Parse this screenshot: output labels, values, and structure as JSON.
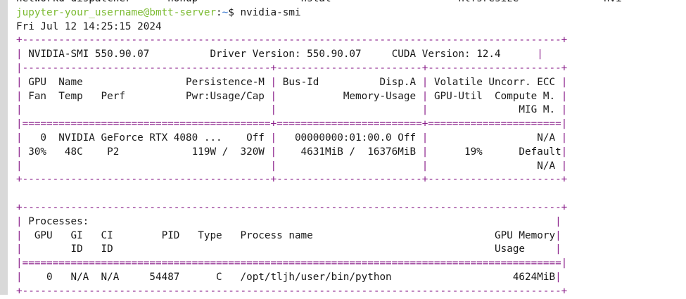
{
  "terminal": {
    "tail_line": "networkd-dispatcher      nohup                 nstat                     ntfsresize              nvi",
    "prompt": {
      "user_host": "jupyter-your_username@bmtt-server",
      "separator": ":",
      "path": "~",
      "symbol": "$ ",
      "command": "nvidia-smi"
    },
    "timestamp": "Fri Jul 12 14:25:15 2024",
    "smi_header": {
      "border": "+-----------------------------------------------------------------------------------------+",
      "smi_version": "NVIDIA-SMI 550.90.07",
      "driver_version": "Driver Version: 550.90.07",
      "cuda_version": "CUDA Version: 12.4"
    },
    "gpu_table": {
      "border_thin": "|-----------------------------------------+------------------------+----------------------+",
      "border_double": "|=========================================+========================+======================|",
      "border_bottom": "+-----------------------------------------+------------------------+----------------------+",
      "header_rows": [
        [
          "GPU  Name                 Persistence-M",
          "Bus-Id          Disp.A",
          "Volatile Uncorr. ECC"
        ],
        [
          "Fan  Temp   Perf          Pwr:Usage/Cap",
          "          Memory-Usage",
          "GPU-Util  Compute M."
        ],
        [
          "",
          "",
          "MIG M."
        ]
      ],
      "gpu_rows": [
        [
          "  0  NVIDIA GeForce RTX 4080 ...    Off",
          "  00000000:01:00.0 Off",
          "N/A"
        ],
        [
          "30%   48C    P2            119W /  320W",
          "   4631MiB /  16376MiB",
          "     19%      Default"
        ],
        [
          "",
          "",
          "N/A"
        ]
      ]
    },
    "processes": {
      "border": "+-----------------------------------------------------------------------------------------+",
      "title": "Processes:",
      "header_rows": [
        " GPU   GI   CI        PID   Type   Process name                              GPU Memory",
        "       ID   ID                                                               Usage"
      ],
      "border_double": "|=========================================================================================|",
      "rows": [
        "   0   N/A  N/A     54487      C   /opt/tljh/user/bin/python                    4624MiB"
      ],
      "border_bottom": "+-----------------------------------------------------------------------------------------+"
    }
  }
}
